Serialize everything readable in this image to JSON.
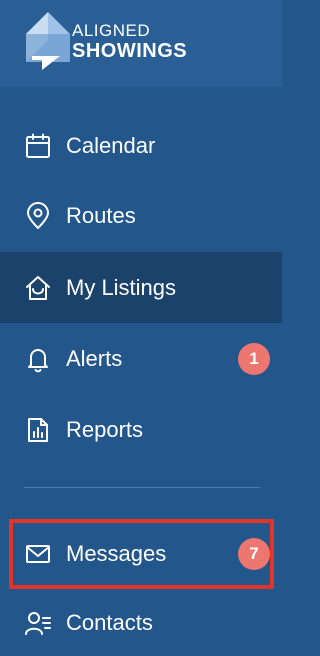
{
  "brand": {
    "line1": "ALIGNED",
    "line2": "SHOWINGS"
  },
  "nav": {
    "items": [
      {
        "label": "Calendar",
        "icon": "calendar-icon"
      },
      {
        "label": "Routes",
        "icon": "map-pin-icon"
      },
      {
        "label": "My Listings",
        "icon": "home-icon",
        "active": true
      },
      {
        "label": "Alerts",
        "icon": "bell-icon",
        "badge": "1"
      },
      {
        "label": "Reports",
        "icon": "report-icon"
      },
      {
        "label": "Messages",
        "icon": "envelope-icon",
        "badge": "7",
        "highlighted": true
      },
      {
        "label": "Contacts",
        "icon": "contacts-icon"
      }
    ]
  },
  "colors": {
    "sidebar_bg": "#23568a",
    "header_bg": "#2a5f95",
    "active_bg": "#1b426b",
    "badge_bg": "#ee7670",
    "highlight_border": "#e3342a"
  }
}
